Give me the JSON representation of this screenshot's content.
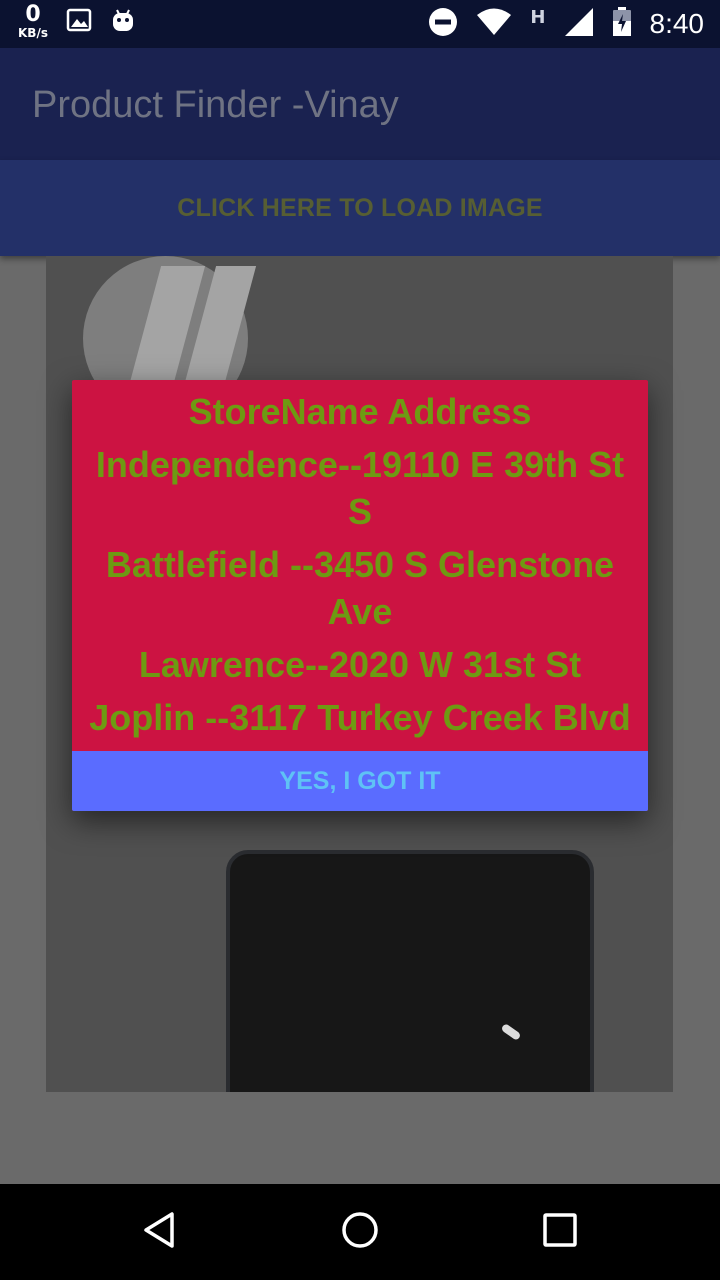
{
  "status_bar": {
    "net_speed_value": "0",
    "net_speed_unit": "KB/s",
    "network_type": "H",
    "time": "8:40"
  },
  "app_bar": {
    "title": "Product Finder -Vinay"
  },
  "load_button": {
    "label": "CLICK HERE TO LOAD IMAGE"
  },
  "dialog": {
    "header": "StoreName  Address",
    "stores": [
      {
        "name": "Independence",
        "address": "--19110 E 39th St S"
      },
      {
        "name": "Battlefield",
        "address": "--3450 S Glenstone Ave"
      },
      {
        "name": "Lawrence",
        "address": "--2020 W 31st St"
      },
      {
        "name": "Joplin",
        "address": "--3117 Turkey Creek Blvd"
      }
    ],
    "confirm_label": "YES, I GOT IT"
  },
  "colors": {
    "dialog_bg": "#cc1342",
    "dialog_text": "#6e9a12",
    "button_bg": "#5a6cff",
    "button_text": "#5fc2f5",
    "app_bar": "#1a2250"
  },
  "icons": {
    "status_left": [
      "gallery-icon",
      "android-icon"
    ],
    "status_right": [
      "do-not-disturb-icon",
      "wifi-icon",
      "cell-signal-icon",
      "battery-icon"
    ],
    "nav": [
      "back-icon",
      "home-icon",
      "recents-icon"
    ]
  }
}
